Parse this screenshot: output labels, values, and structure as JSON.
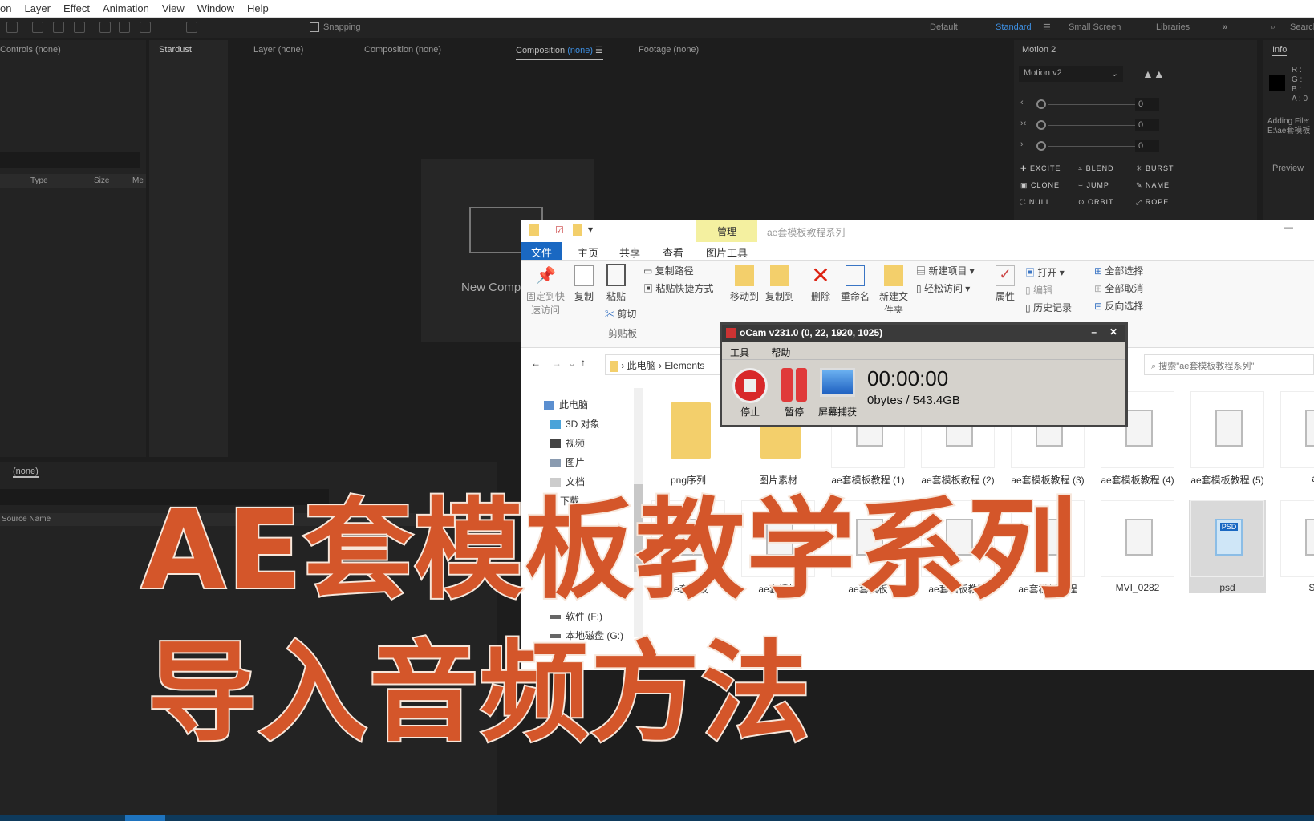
{
  "menu": [
    "on",
    "Layer",
    "Effect",
    "Animation",
    "View",
    "Window",
    "Help"
  ],
  "toolbar": {
    "snapping": "Snapping",
    "workspaces": [
      "Default",
      "Standard",
      "Small Screen",
      "Libraries"
    ],
    "active_workspace": "Standard",
    "search": "Search"
  },
  "panels": {
    "controls": "Controls (none)",
    "stardust": "Stardust",
    "layer": "Layer (none)",
    "composition1": "Composition (none)",
    "composition2": "Composition",
    "composition2_none": "(none)",
    "footage": "Footage (none)",
    "motion": "Motion 2",
    "info": "Info"
  },
  "project": {
    "columns": [
      "Type",
      "Size",
      "Me"
    ]
  },
  "viewer": {
    "new_comp": "New Composition"
  },
  "timeline": {
    "tab": "(none)",
    "column": "Source Name"
  },
  "motion": {
    "preset": "Motion v2",
    "values": [
      "0",
      "0",
      "0"
    ],
    "buttons": [
      "EXCITE",
      "BLEND",
      "BURST",
      "CLONE",
      "JUMP",
      "NAME",
      "NULL",
      "ORBIT",
      "ROPE"
    ]
  },
  "info": {
    "r": "R :",
    "g": "G :",
    "b": "B :",
    "a": "A :  0",
    "adding": "Adding File:",
    "path": "E:\\ae套模板",
    "preview": "Preview"
  },
  "explorer": {
    "title": "ae套模板教程系列",
    "manage": "管理",
    "tabs": [
      "文件",
      "主页",
      "共享",
      "查看",
      "图片工具"
    ],
    "ribbon": {
      "pin": "固定到快速访问",
      "copy": "复制",
      "paste": "粘贴",
      "copy_path": "复制路径",
      "paste_shortcut": "粘贴快捷方式",
      "cut": "剪切",
      "clipboard": "剪贴板",
      "move_to": "移动到",
      "copy_to": "复制到",
      "delete": "删除",
      "rename": "重命名",
      "new_folder": "新建文件夹",
      "new_item": "新建项目 ▾",
      "easy_access": "轻松访问 ▾",
      "properties": "属性",
      "open": "打开 ▾",
      "edit": "编辑",
      "history": "历史记录",
      "select_all": "全部选择",
      "select_none": "全部取消",
      "invert": "反向选择"
    },
    "breadcrumb": [
      "此电脑",
      "Elements"
    ],
    "search_placeholder": "搜索\"ae套模板教程系列\"",
    "nav": [
      "此电脑",
      "3D 对象",
      "视频",
      "图片",
      "文档",
      "下载",
      "软件 (F:)",
      "本地磁盘 (G:)"
    ],
    "files_row1": [
      {
        "name": "png序列",
        "type": "folder"
      },
      {
        "name": "图片素材",
        "type": "folder"
      },
      {
        "name": "ae套模板教程 (1)",
        "type": "file"
      },
      {
        "name": "ae套模板教程 (2)",
        "type": "file"
      },
      {
        "name": "ae套模板教程 (3)",
        "type": "file"
      },
      {
        "name": "ae套模板教程 (4)",
        "type": "file"
      },
      {
        "name": "ae套模板教程 (5)",
        "type": "file"
      },
      {
        "name": "ae",
        "type": "file"
      }
    ],
    "files_row2": [
      {
        "name": "ae套模板",
        "type": "file"
      },
      {
        "name": "ae套模板",
        "type": "file"
      },
      {
        "name": "ae套模板",
        "type": "file"
      },
      {
        "name": "ae套模板教程",
        "type": "file"
      },
      {
        "name": "ae套模板教程",
        "type": "file"
      },
      {
        "name": "MVI_0282",
        "type": "file"
      },
      {
        "name": "psd",
        "type": "psd"
      },
      {
        "name": "Spri",
        "type": "file"
      }
    ]
  },
  "ocam": {
    "title": "oCam v231.0 (0, 22, 1920, 1025)",
    "menu": [
      "工具",
      "帮助"
    ],
    "stop": "停止",
    "pause": "暂停",
    "capture": "屏幕捕获",
    "time": "00:00:00",
    "size": "0bytes / 543.4GB"
  },
  "overlay": {
    "line1": "AE套模板教学系列",
    "line2": "导入音频方法",
    "color": "#d4562a"
  }
}
